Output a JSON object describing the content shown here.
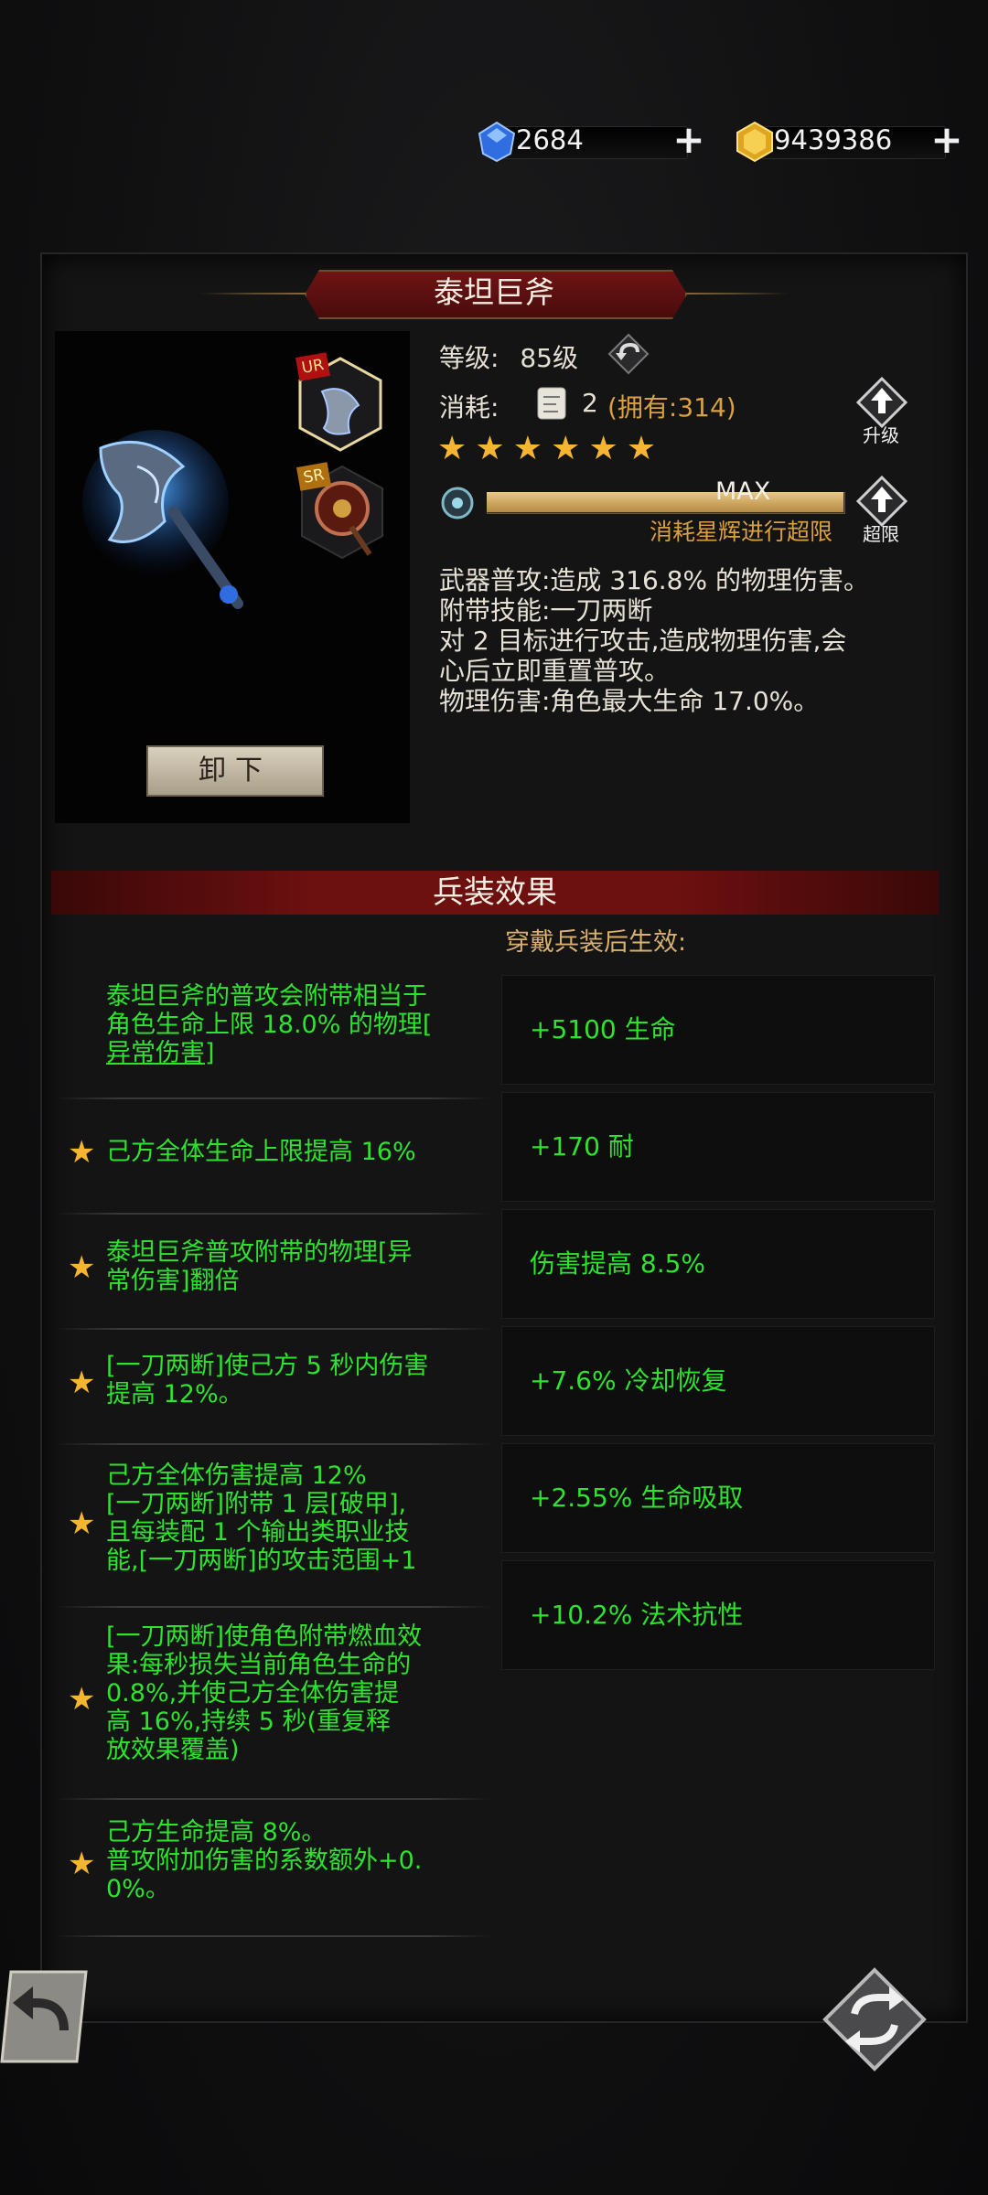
{
  "currency": {
    "gems": "2684",
    "gold": "9439386"
  },
  "weapon": {
    "name": "泰坦巨斧",
    "level_label": "等级:",
    "level_value": "85级",
    "cost_label": "消耗:",
    "cost_count": "2",
    "cost_owned": "(拥有:314)",
    "stars": 6,
    "progress_text": "MAX",
    "progress_hint": "消耗星辉进行超限",
    "upgrade_label": "升级",
    "limit_break_label": "超限",
    "badge_ur": "UR",
    "badge_sr": "SR",
    "unequip_label": "卸下",
    "desc_lines": [
      "武器普攻:造成 316.8% 的物理伤害。",
      "附带技能:一刀两断",
      "对 2 目标进行攻击,造成物理伤害,会",
      "心后立即重置普攻。",
      "物理伤害:角色最大生命 17.0%。"
    ]
  },
  "effects": {
    "title": "兵装效果",
    "subtitle": "穿戴兵装后生效:",
    "left": [
      {
        "lines": [
          "泰坦巨斧的普攻会附带相当于",
          "角色生命上限 18.0% 的物理[",
          "异常伤害]"
        ],
        "star": false
      },
      {
        "lines": [
          "己方全体生命上限提高 16%"
        ],
        "star": true
      },
      {
        "lines": [
          "泰坦巨斧普攻附带的物理[异",
          "常伤害]翻倍"
        ],
        "star": true
      },
      {
        "lines": [
          "[一刀两断]使己方 5 秒内伤害",
          "提高 12%。"
        ],
        "star": true
      },
      {
        "lines": [
          "己方全体伤害提高 12%",
          "[一刀两断]附带 1 层[破甲],",
          "且每装配 1 个输出类职业技",
          "能,[一刀两断]的攻击范围+1"
        ],
        "star": true
      },
      {
        "lines": [
          "[一刀两断]使角色附带燃血效",
          "果:每秒损失当前角色生命的",
          "0.8%,并使己方全体伤害提",
          "高 16%,持续 5 秒(重复释",
          "放效果覆盖)"
        ],
        "star": true
      },
      {
        "lines": [
          "己方生命提高 8%。",
          "普攻附加伤害的系数额外+0.",
          "0%。"
        ],
        "star": true
      }
    ],
    "right": [
      "+5100 生命",
      "+170 耐",
      "伤害提高 8.5%",
      "+7.6% 冷却恢复",
      "+2.55% 生命吸取",
      "+10.2% 法术抗性"
    ]
  },
  "icons": {
    "gem": "blue-gem-icon",
    "gold": "gold-coin-icon",
    "back": "back-arrow-icon",
    "swap": "swap-icon",
    "star": "star-icon"
  },
  "colors": {
    "effect_text": "#2ee32e",
    "star": "#f5b531",
    "banner": "#6e1414",
    "accent_gold": "#d8b070"
  }
}
